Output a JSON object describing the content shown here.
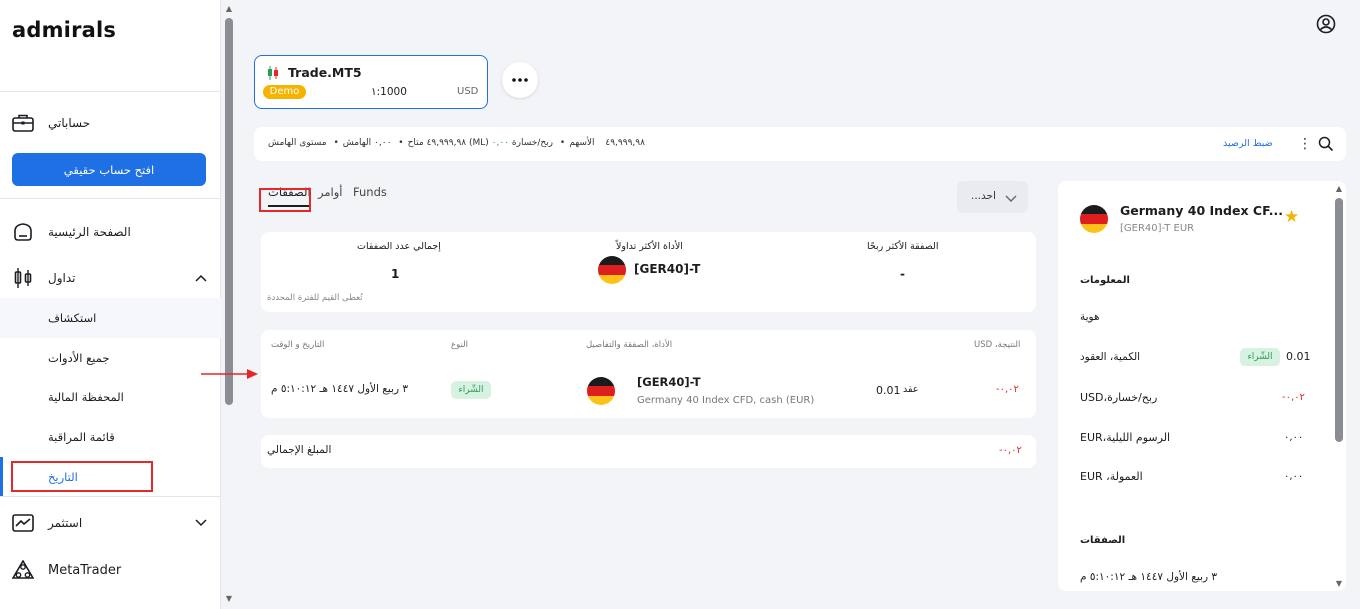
{
  "sidebar": {
    "logo": "admirals",
    "accounts_label": "حساباتي",
    "open_real_button": "افتح حساب حقيقي",
    "home_label": "الصفحة الرئيسية",
    "trading_label": "تداول",
    "sub_items": {
      "explore": "استكشاف",
      "all_instruments": "جميع الأدوات",
      "portfolio": "المحفظة المالية",
      "watchlist": "قائمة المراقبة",
      "history": "التاريخ"
    },
    "invest_label": "استثمر",
    "metatrader_label": "MetaTrader"
  },
  "account": {
    "name": "Trade.MT5",
    "badge": "Demo",
    "leverage": "١:1000",
    "currency": "USD"
  },
  "stats": {
    "available": "٤٩,٩٩٩,٩٨ متاح",
    "margin": "٠,٠٠ الهامش",
    "margin_level": "مستوى الهامش (ML)",
    "equity": "٤٩,٩٩٩,٩٨ الأسهم",
    "pnl_label": "ربح/خسارة",
    "pnl_value": "٠,٠٠",
    "reset_link": "ضبط الرصيد"
  },
  "tabs": {
    "deals": "الصفقات",
    "orders": "أوامر",
    "funds": "Funds"
  },
  "period_select": "...احد",
  "summary": {
    "total_deals_title": "إجمالي عدد الصفقات",
    "total_deals_value": "1",
    "most_traded_title": "الأداة الأكثر تداولاً",
    "most_traded_value": "[GER40]-T",
    "most_profitable_title": "الصفقة الأكثر ربحًا",
    "most_profitable_value": "-",
    "note": "تُعطى القيم للفترة المحددة"
  },
  "deals_table": {
    "headers": {
      "datetime": "التاريخ و الوقت",
      "type": "النوع",
      "instrument": "الأداة، الصفقة والتفاصيل",
      "result": "USD ،النتيجة"
    },
    "row": {
      "datetime": "٣ ربيع الأول ١٤٤٧ هـ ٥:١٠:١٢ م",
      "type": "الشّراء",
      "symbol": "[GER40]-T",
      "description": "Germany 40 Index CFD, cash (EUR)",
      "volume": "0.01",
      "volume_unit": "عقد",
      "result": "-٠,٠٢"
    }
  },
  "total": {
    "label": "المبلغ الإجمالي",
    "value": "-٠,٠٢"
  },
  "right_panel": {
    "title": "Germany 40 Index CF...",
    "subtitle": "[GER40]-T EUR",
    "info_section": "المعلومات",
    "identity_label": "هوية",
    "quantity_label": "الكمية، العقود",
    "quantity_type": "الشّراء",
    "quantity_value": "0.01",
    "pnl_label": "USD،ربح/خسارة",
    "pnl_value": "-٠,٠٢",
    "swap_label": "EUR،الرسوم الليلية",
    "swap_value": "٠,٠٠",
    "commission_label": "EUR ،العمولة",
    "commission_value": "٠,٠٠",
    "deals_section": "الصفقات",
    "deal_datetime": "٣ ربيع الأول ١٤٤٧ هـ ٥:١٠:١٢ م"
  }
}
